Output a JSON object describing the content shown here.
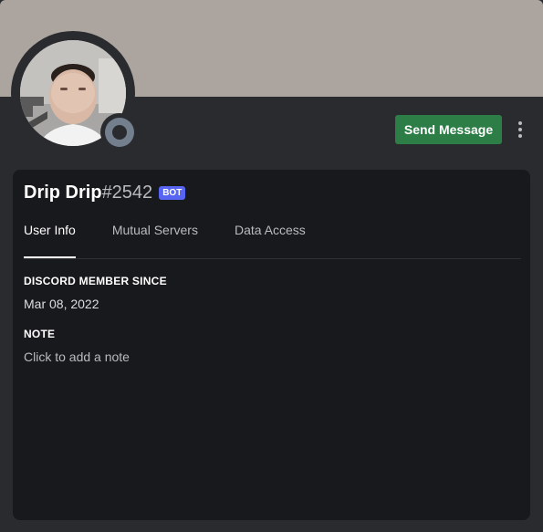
{
  "profile": {
    "username": "Drip Drip",
    "discriminator": "#2542",
    "bot_tag": "BOT",
    "status": "offline"
  },
  "actions": {
    "send_message_label": "Send Message"
  },
  "tabs": [
    {
      "label": "User Info",
      "active": true
    },
    {
      "label": "Mutual Servers",
      "active": false
    },
    {
      "label": "Data Access",
      "active": false
    }
  ],
  "user_info": {
    "member_since_label": "DISCORD MEMBER SINCE",
    "member_since_value": "Mar 08, 2022",
    "note_label": "NOTE",
    "note_placeholder": "Click to add a note"
  },
  "colors": {
    "banner": "#aca49f",
    "send_button": "#2d7d46",
    "bot_badge": "#5865f2",
    "status_offline": "#747f8d"
  }
}
